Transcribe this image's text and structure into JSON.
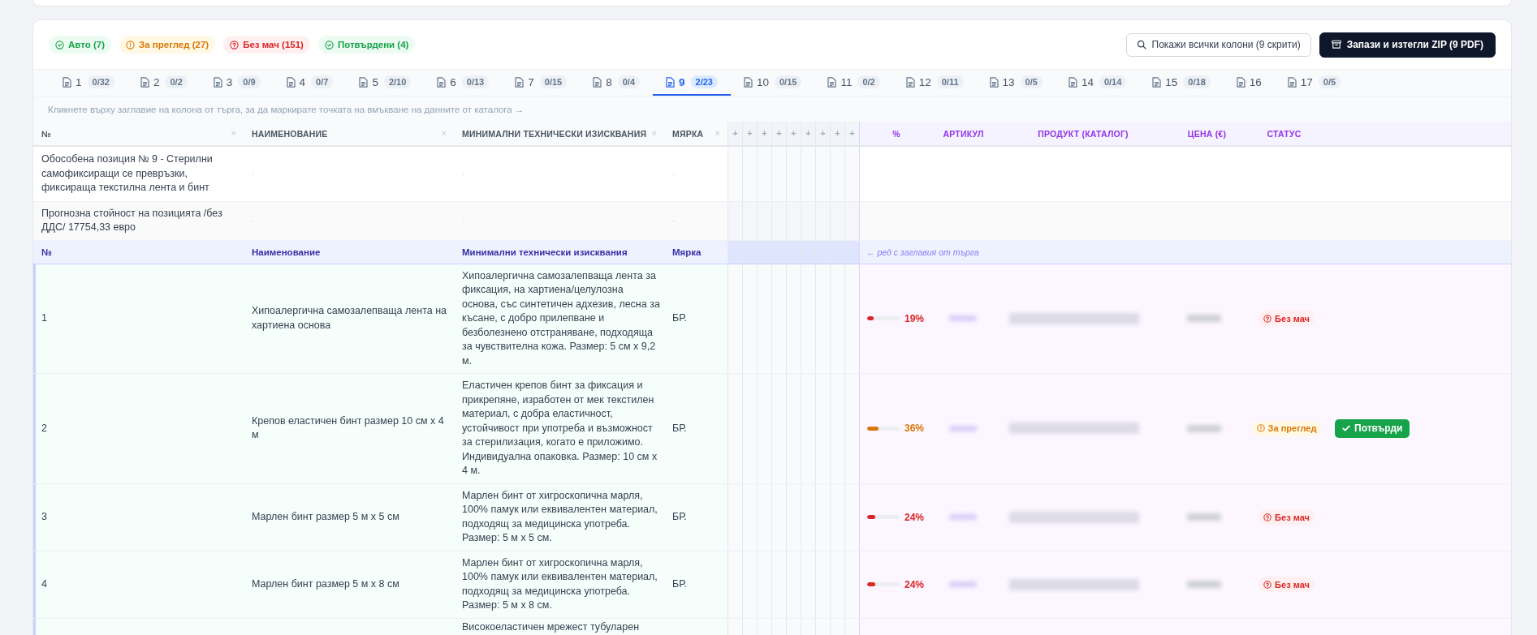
{
  "summary_badges": [
    {
      "kind": "auto",
      "label": "Авто (7)"
    },
    {
      "kind": "review",
      "label": "За преглед (27)"
    },
    {
      "kind": "no_match",
      "label": "Без мач (151)"
    },
    {
      "kind": "confirmed",
      "label": "Потвърдени (4)"
    }
  ],
  "toolbar_buttons": [
    {
      "kind": "outline",
      "label": "Покажи всички колони (9 скрити)"
    },
    {
      "kind": "primary",
      "label": "Запази и изтегли ZIP (9 PDF)"
    }
  ],
  "tabs": [
    {
      "number": "1",
      "count": "0/32",
      "selected": false
    },
    {
      "number": "2",
      "count": "0/2",
      "selected": false
    },
    {
      "number": "3",
      "count": "0/9",
      "selected": false
    },
    {
      "number": "4",
      "count": "0/7",
      "selected": false
    },
    {
      "number": "5",
      "count": "2/10",
      "selected": false
    },
    {
      "number": "6",
      "count": "0/13",
      "selected": false
    },
    {
      "number": "7",
      "count": "0/15",
      "selected": false
    },
    {
      "number": "8",
      "count": "0/4",
      "selected": false
    },
    {
      "number": "9",
      "count": "2/23",
      "selected": true
    },
    {
      "number": "10",
      "count": "0/15",
      "selected": false
    },
    {
      "number": "11",
      "count": "0/2",
      "selected": false
    },
    {
      "number": "12",
      "count": "0/11",
      "selected": false
    },
    {
      "number": "13",
      "count": "0/5",
      "selected": false
    },
    {
      "number": "14",
      "count": "0/14",
      "selected": false
    },
    {
      "number": "15",
      "count": "0/18",
      "selected": false
    },
    {
      "number": "16",
      "selected": false
    },
    {
      "number": "17",
      "count": "0/5",
      "selected": false
    }
  ],
  "hint": "Кликнете върху заглавие на колона от търга, за да маркирате точката на вмъкване на данните от каталога →",
  "table": {
    "tender_columns": [
      {
        "label": "№",
        "remove": "×"
      },
      {
        "label": "НАИМЕНОВАНИЕ",
        "remove": "×"
      },
      {
        "label": "МИНИМАЛНИ ТЕХНИЧЕСКИ ИЗИСКВАНИЯ",
        "remove": "×"
      },
      {
        "label": "МЯРКА",
        "remove": "×"
      }
    ],
    "insert_columns": [
      "+",
      "+",
      "+",
      "+",
      "+",
      "+",
      "+",
      "+",
      "+"
    ],
    "catalog_columns": [
      "%",
      "АРТИКУЛ",
      "ПРОДУКТ (КАТАЛОГ)",
      "ЦЕНА (€)",
      "СТАТУС"
    ],
    "rows": [
      {
        "kind": "lot_title",
        "number": "Обособена позиция № 9 - Стерилни самофиксиращи се превръзки, фиксираща текстилна лента и бинт",
        "name": "·",
        "requirements": "·",
        "unit": "·"
      },
      {
        "kind": "estimate",
        "number": "Прогнозна стойност на позицията /без ДДС/ 17754,33 евро",
        "name": "·",
        "requirements": "·",
        "unit": "·"
      },
      {
        "kind": "header",
        "number": "№",
        "name": "Наименование",
        "requirements": "Минимални технически изисквания",
        "unit": "Мярка",
        "note": "← ред с заглавия от търга"
      },
      {
        "kind": "item",
        "number": "1",
        "name": "Хипоалергична самозалепваща лента на хартиена основа",
        "requirements": "Хипоалергична самозалепваща лента за фиксация, на хартиена/целулозна основа, със синтетичен адхезив, лесна за късане, с добро прилепване и безболезнено отстраняване, подходяща за чувствителна кожа. Размер: 5 см х 9,2 м.",
        "unit": "БР.",
        "match": {
          "level": 0.19,
          "percent": "19%",
          "status": {
            "kind": "no_match",
            "label": "Без мач"
          }
        }
      },
      {
        "kind": "item",
        "number": "2",
        "name": "Крепов еластичен бинт размер 10 см х 4 м",
        "requirements": "Еластичен крепов бинт за фиксация и прикрепяне, изработен от мек текстилен материал, с добра еластичност, устойчивост при употреба и възможност за стерилизация, когато е приложимо. Индивидуална опаковка. Размер: 10 см х 4 м.",
        "unit": "БР.",
        "match": {
          "level": 0.36,
          "percent": "36%",
          "status": {
            "kind": "review",
            "label": "За преглед"
          },
          "action": "Потвърди"
        }
      },
      {
        "kind": "item",
        "number": "3",
        "name": "Марлен бинт размер 5 м х 5 см",
        "requirements": "Марлен бинт от хигроскопична марля, 100% памук или еквивалентен материал, подходящ за медицинска употреба. Размер: 5 м х 5 см.",
        "unit": "БР.",
        "match": {
          "level": 0.24,
          "percent": "24%",
          "status": {
            "kind": "no_match",
            "label": "Без мач"
          }
        }
      },
      {
        "kind": "item",
        "number": "4",
        "name": "Марлен бинт размер 5 м х 8 см",
        "requirements": "Марлен бинт от хигроскопична марля, 100% памук или еквивалентен материал, подходящ за медицинска употреба. Размер: 5 м х 8 см.",
        "unit": "БР.",
        "match": {
          "level": 0.24,
          "percent": "24%",
          "status": {
            "kind": "no_match",
            "label": "Без мач"
          }
        }
      },
      {
        "kind": "item",
        "requirements": "Високоеластичен мрежест тубуларен"
      }
    ]
  }
}
